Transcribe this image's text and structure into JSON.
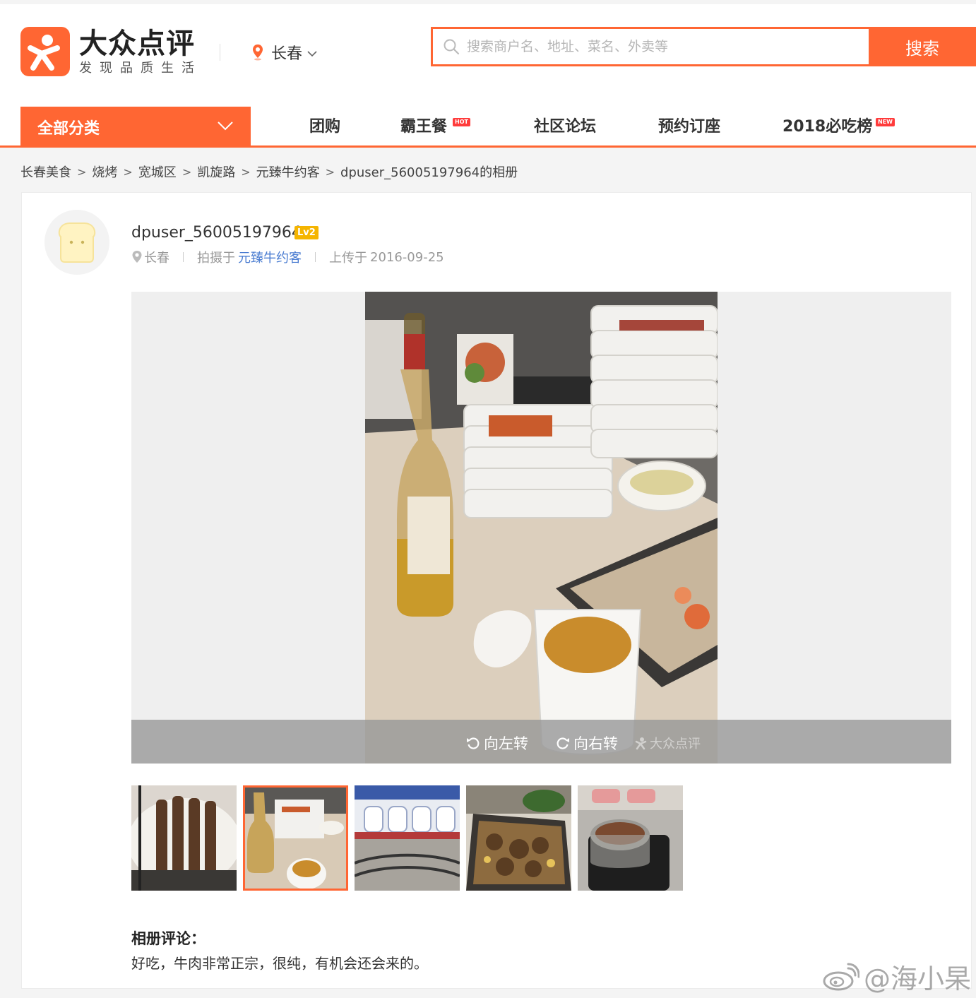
{
  "brand": {
    "name": "大众点评",
    "slogan": "发现品质生活",
    "accent_color": "#ff6633"
  },
  "city": {
    "name": "长春",
    "icon": "location-pin-icon"
  },
  "search": {
    "placeholder": "搜索商户名、地址、菜名、外卖等",
    "button_label": "搜索"
  },
  "nav": {
    "category_label": "全部分类",
    "items": [
      {
        "label": "团购"
      },
      {
        "label": "霸王餐",
        "tag": "HOT"
      },
      {
        "label": "社区论坛"
      },
      {
        "label": "预约订座"
      },
      {
        "label": "2018必吃榜",
        "tag": "NEW"
      }
    ]
  },
  "breadcrumb": [
    "长春美食",
    "烧烤",
    "宽城区",
    "凯旋路",
    "元臻牛约客",
    "dpuser_56005197964的相册"
  ],
  "breadcrumb_separator": ">",
  "uploader": {
    "username": "dpuser_56005197964",
    "level": "Lv2",
    "city": "长春",
    "shot_at_prefix": "拍摄于",
    "shop": "元臻牛约客",
    "uploaded_prefix": "上传于",
    "upload_date": "2016-09-25"
  },
  "viewer": {
    "rotate_left_label": "向左转",
    "rotate_right_label": "向右转",
    "watermark": "大众点评"
  },
  "thumbnails": [
    {
      "subject": "meat skewers"
    },
    {
      "subject": "beer and tea",
      "active": true
    },
    {
      "subject": "restaurant interior"
    },
    {
      "subject": "grilled meat"
    },
    {
      "subject": "hot pot"
    }
  ],
  "comments": {
    "title": "相册评论：",
    "text": "好吃，牛肉非常正宗，很纯，有机会还会来的。"
  },
  "weibo_watermark": "@海小杲"
}
